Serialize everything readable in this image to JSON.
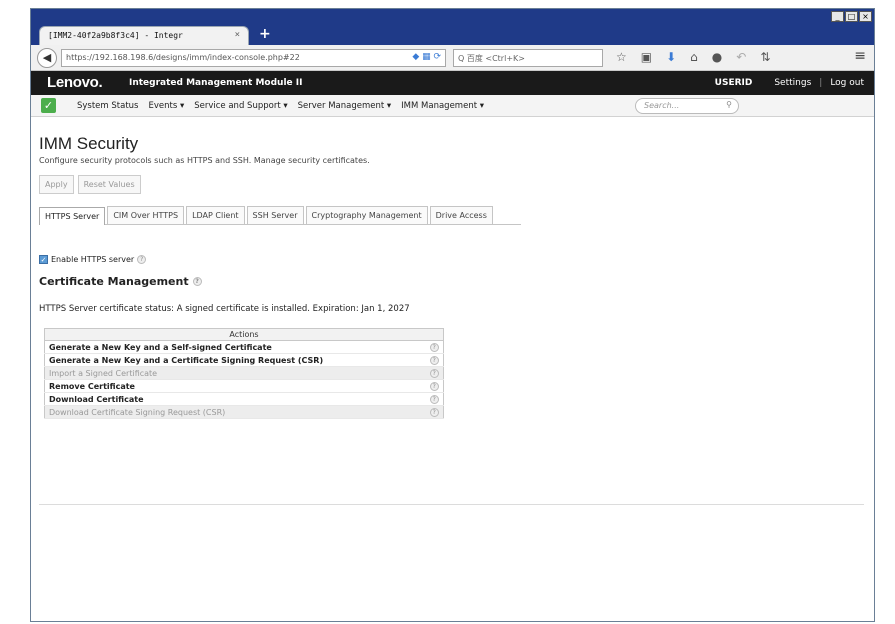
{
  "browser": {
    "tab_title": "[IMM2-40f2a9b8f3c4] - Integr",
    "tab_close": "×",
    "new_tab": "+",
    "url": "https://192.168.198.6/designs/imm/index-console.php#22",
    "search_placeholder": "Q 百度 <Ctrl+K>",
    "window_buttons": [
      "_",
      "□",
      "×"
    ],
    "toolbar_icons": [
      "star-icon",
      "clipboard-icon",
      "download-icon",
      "home-icon",
      "chat-icon",
      "undo-icon",
      "addon-icon",
      "menu-icon"
    ]
  },
  "header": {
    "logo": "Lenovo.",
    "product": "Integrated Management Module II",
    "user": "USERID",
    "settings": "Settings",
    "separator": "|",
    "logout": "Log out"
  },
  "menu": {
    "items": [
      "System Status",
      "Events ▾",
      "Service and Support ▾",
      "Server Management ▾",
      "IMM Management ▾"
    ],
    "search_placeholder": "Search..."
  },
  "page": {
    "title": "IMM Security",
    "description": "Configure security protocols such as HTTPS and SSH. Manage security certificates.",
    "apply": "Apply",
    "reset": "Reset Values",
    "tabs": [
      "HTTPS Server",
      "CIM Over HTTPS",
      "LDAP Client",
      "SSH Server",
      "Cryptography Management",
      "Drive Access"
    ],
    "enable_label": "Enable HTTPS server",
    "section_title": "Certificate Management",
    "status_line": "HTTPS Server certificate status: A signed certificate is installed. Expiration: Jan 1, 2027",
    "actions_header": "Actions",
    "actions": [
      {
        "label": "Generate a New Key and a Self-signed Certificate",
        "enabled": true
      },
      {
        "label": "Generate a New Key and a Certificate Signing Request (CSR)",
        "enabled": true
      },
      {
        "label": "Import a Signed Certificate",
        "enabled": false
      },
      {
        "label": "Remove Certificate",
        "enabled": true
      },
      {
        "label": "Download Certificate",
        "enabled": true
      },
      {
        "label": "Download Certificate Signing Request (CSR)",
        "enabled": false
      }
    ]
  }
}
